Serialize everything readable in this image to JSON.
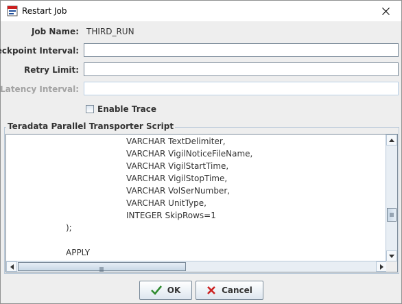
{
  "window": {
    "title": "Restart Job"
  },
  "form": {
    "job_name_label": "Job Name:",
    "job_name_value": "THIRD_RUN",
    "checkpoint_label": "Checkpoint Interval:",
    "checkpoint_value": "",
    "retry_label": "Retry Limit:",
    "retry_value": "",
    "latency_label": "Latency Interval:",
    "latency_value": "",
    "enable_trace_label": "Enable Trace",
    "enable_trace_checked": false
  },
  "script": {
    "group_title": "Teradata Parallel Transporter Script",
    "lines": [
      "VARCHAR TextDelimiter,",
      "VARCHAR VigilNoticeFileName,",
      "VARCHAR VigilStartTime,",
      "VARCHAR VigilStopTime,",
      "VARCHAR VolSerNumber,",
      "VARCHAR UnitType,",
      "INTEGER SkipRows=1",
      ");",
      "",
      "APPLY",
      "("
    ]
  },
  "buttons": {
    "ok_label": "OK",
    "cancel_label": "Cancel"
  },
  "icons": {
    "app": "restart-job-icon",
    "close": "close-icon",
    "ok": "checkmark-icon",
    "cancel": "x-mark-icon"
  },
  "colors": {
    "ok_check": "#2e8b2e",
    "cancel_x": "#cc2020"
  }
}
